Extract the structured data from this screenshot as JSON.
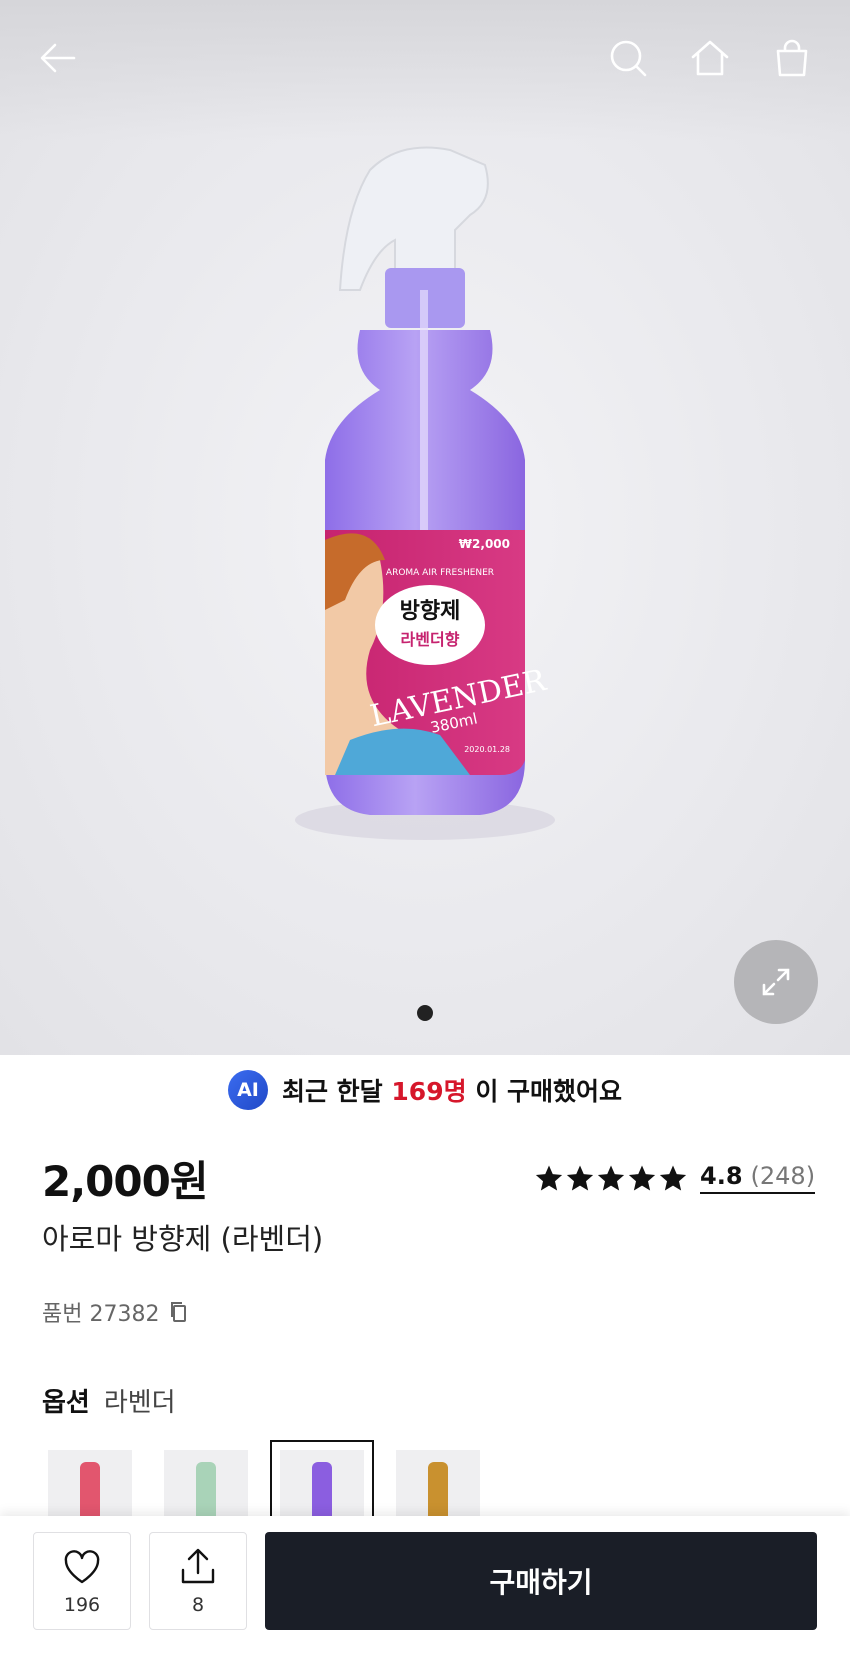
{
  "header": {
    "back_icon": "arrow-left-icon",
    "search_icon": "search-icon",
    "home_icon": "home-icon",
    "cart_icon": "shopping-bag-icon"
  },
  "gallery": {
    "label_brand": "AROMA AIR FRESHENER",
    "label_title": "방향제",
    "label_subtitle": "라벤더향",
    "label_name": "LAVENDER",
    "label_volume": "380ml",
    "label_price": "₩2,000",
    "label_date": "2020.01.28",
    "slide_count": 1,
    "current_slide": 1,
    "expand_icon": "expand-icon"
  },
  "purchase_stat": {
    "badge": "AI",
    "prefix": "최근 한달",
    "count": "169명",
    "suffix": "이 구매했어요"
  },
  "product": {
    "price": "2,000원",
    "title": "아로마 방향제 (라벤더)",
    "rating": "4.8",
    "rating_count": "(248)",
    "stars": 5,
    "sku": "품번 27382",
    "copy_icon": "copy-icon"
  },
  "option": {
    "label": "옵션",
    "value": "라벤더",
    "thumbs": [
      {
        "name": "rose",
        "color": "#e2566e"
      },
      {
        "name": "green",
        "color": "#a9d3b8"
      },
      {
        "name": "lavender",
        "color": "#8b5ee0",
        "selected": true
      },
      {
        "name": "amber",
        "color": "#c9912f"
      }
    ]
  },
  "actions": {
    "like_count": "196",
    "share_count": "8",
    "buy_label": "구매하기"
  }
}
